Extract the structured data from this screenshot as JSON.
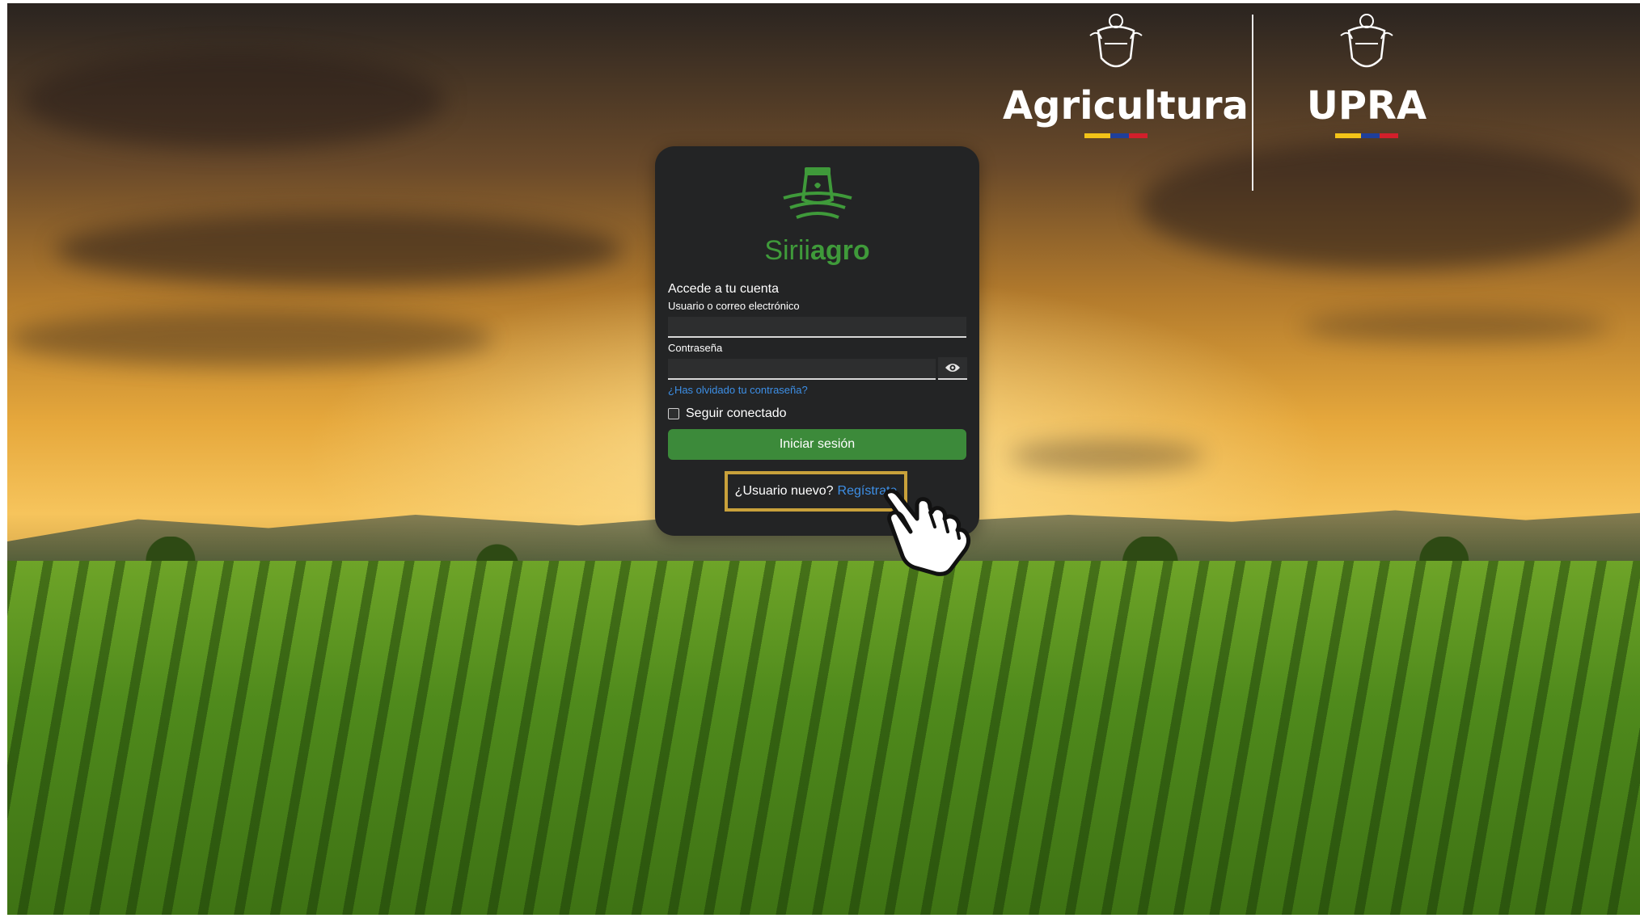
{
  "header": {
    "agency_1": "Agricultura",
    "agency_2": "UPRA",
    "flag_colors": [
      "#f3c318",
      "#1f3f9a",
      "#d21f2b"
    ]
  },
  "brand": {
    "name_part1": "Sirii",
    "name_part2": "agro",
    "color": "#3f9a3a"
  },
  "login": {
    "heading": "Accede a tu cuenta",
    "username_label": "Usuario o correo electrónico",
    "username_value": "",
    "password_label": "Contraseña",
    "password_value": "",
    "show_password_icon": "eye-icon",
    "forgot_link": "¿Has olvidado tu contraseña?",
    "remember_label": "Seguir conectado",
    "remember_checked": false,
    "submit_label": "Iniciar sesión",
    "submit_color": "#3c8a3a",
    "register_prompt": "¿Usuario nuevo?",
    "register_link": "Regístrate",
    "link_color": "#3d8fe6",
    "highlight_color": "#c9a13b"
  },
  "overlay": {
    "pointer_icon": "hand-pointer-icon"
  }
}
